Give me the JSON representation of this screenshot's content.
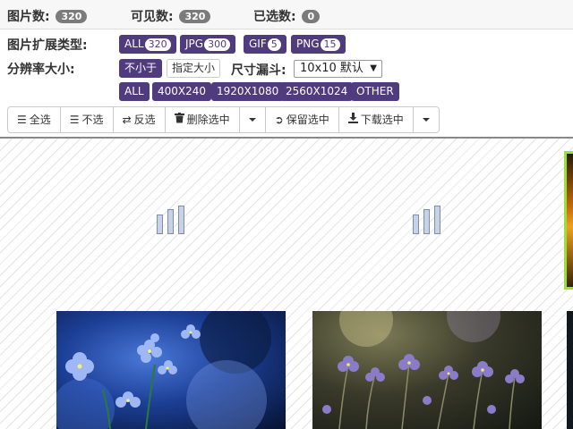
{
  "stats": {
    "images_label": "图片数:",
    "images_count": "320",
    "visible_label": "可见数:",
    "visible_count": "320",
    "selected_label": "已选数:",
    "selected_count": "0"
  },
  "filters": {
    "ext_label": "图片扩展类型:",
    "ext_tags": [
      {
        "name": "ALL",
        "count": "320"
      },
      {
        "name": "JPG",
        "count": "300"
      },
      {
        "name": "GIF",
        "count": "5"
      },
      {
        "name": "PNG",
        "count": "15"
      }
    ],
    "res_label": "分辨率大小:",
    "mode_options": [
      "不小于",
      "指定大小"
    ],
    "mode_selected": "不小于",
    "funnel_label": "尺寸漏斗:",
    "funnel_value": "10x10 默认",
    "sizes": [
      "ALL",
      "400X240",
      "1920X1080",
      "2560X1024",
      "OTHER"
    ]
  },
  "toolbar": {
    "select_all": "全选",
    "select_none": "不选",
    "invert": "反选",
    "delete_selected": "删除选中",
    "keep_selected": "保留选中",
    "download_selected": "下载选中"
  },
  "colors": {
    "accent": "#4f3b7e",
    "badge_gray": "#7b7b7b",
    "highlight_green": "#9be03a"
  },
  "icons": {
    "select_all": "list-icon",
    "select_none": "list-icon",
    "invert": "retweet-icon",
    "delete": "trash-icon",
    "keep": "log-in-icon",
    "download": "download-icon",
    "loader": "loading-bars-icon"
  }
}
